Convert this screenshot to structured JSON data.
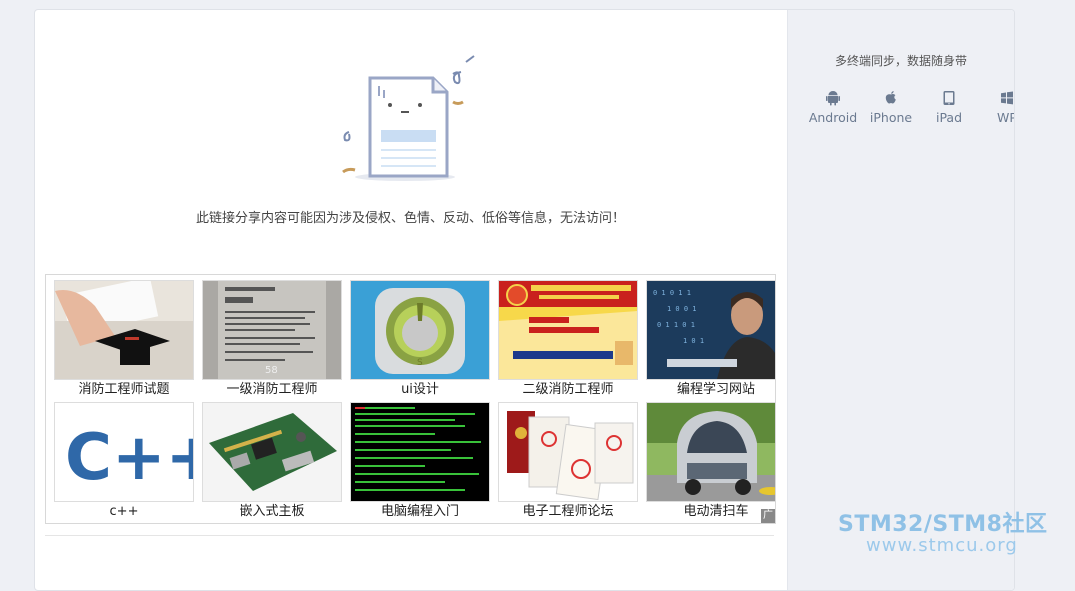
{
  "sidebar": {
    "title": "多终端同步，数据随身带",
    "devices": [
      {
        "label": "Android",
        "icon": "android-icon"
      },
      {
        "label": "iPhone",
        "icon": "apple-icon"
      },
      {
        "label": "iPad",
        "icon": "tablet-icon"
      },
      {
        "label": "WP",
        "icon": "windows-icon"
      }
    ]
  },
  "main": {
    "message": "此链接分享内容可能因为涉及侵权、色情、反动、低俗等信息，无法访问！"
  },
  "ads": {
    "tag": "广",
    "items": [
      {
        "label": "消防工程师试题",
        "thumb": "graduation-cap-photo"
      },
      {
        "label": "一级消防工程师",
        "thumb": "exam-paper-photo"
      },
      {
        "label": "ui设计",
        "thumb": "ui-app-icon"
      },
      {
        "label": "二级消防工程师",
        "thumb": "fire-engineer-banner"
      },
      {
        "label": "编程学习网站",
        "thumb": "coder-photo"
      },
      {
        "label": "c++",
        "thumb": "cpp-logo"
      },
      {
        "label": "嵌入式主板",
        "thumb": "circuit-board-photo"
      },
      {
        "label": "电脑编程入门",
        "thumb": "terminal-screen"
      },
      {
        "label": "电子工程师论坛",
        "thumb": "certificates-photo"
      },
      {
        "label": "电动清扫车",
        "thumb": "sweeper-vehicle-photo"
      }
    ]
  },
  "watermark": {
    "line1": "STM32/STM8社区",
    "line2": "www.stmcu.org"
  },
  "colors": {
    "accent": "#6b7a90",
    "watermark": "#8fc1e6"
  }
}
